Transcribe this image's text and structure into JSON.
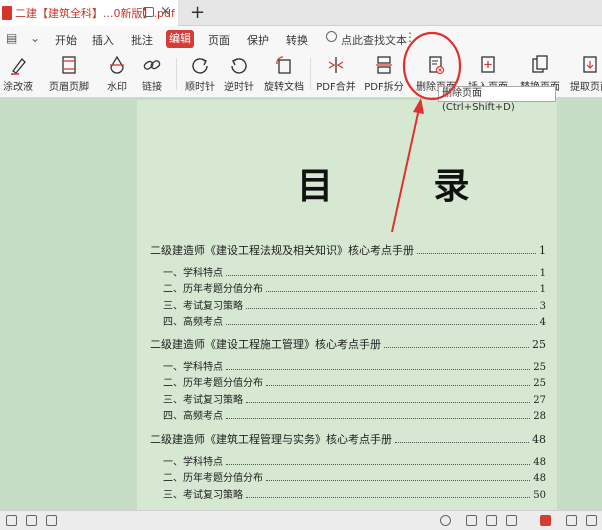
{
  "tab": {
    "title": "二建【建筑全科】...0新版】.pdf",
    "close": "×",
    "add": "+"
  },
  "menu": {
    "items": [
      "开始",
      "插入",
      "批注",
      "编辑",
      "页面",
      "保护",
      "转换"
    ],
    "active": "编辑",
    "search": "点此查找文本"
  },
  "toolbar": {
    "items": [
      {
        "label": "涂改液",
        "icon": "eraser-pen-icon"
      },
      {
        "label": "页眉页脚",
        "icon": "header-footer-icon"
      },
      {
        "label": "水印",
        "icon": "watermark-icon"
      },
      {
        "label": "链接",
        "icon": "link-icon"
      },
      {
        "label": "顺时针",
        "icon": "rotate-cw-icon"
      },
      {
        "label": "逆时针",
        "icon": "rotate-ccw-icon"
      },
      {
        "label": "旋转文档",
        "icon": "rotate-doc-icon"
      },
      {
        "label": "PDF合并",
        "icon": "pdf-merge-icon"
      },
      {
        "label": "PDF拆分",
        "icon": "pdf-split-icon"
      },
      {
        "label": "删除页面",
        "icon": "delete-page-icon"
      },
      {
        "label": "插入页面",
        "icon": "insert-page-icon"
      },
      {
        "label": "替换页面",
        "icon": "replace-page-icon"
      },
      {
        "label": "提取页面",
        "icon": "extract-page-icon"
      }
    ]
  },
  "tooltip": "删除页面 (Ctrl+Shift+D)",
  "document": {
    "title": "目 录",
    "toc": [
      {
        "text": "二级建造师《建设工程法规及相关知识》核心考点手册",
        "page": "1",
        "level": "main"
      },
      {
        "text": "一、学科特点",
        "page": "1",
        "level": "sub"
      },
      {
        "text": "二、历年考题分值分布",
        "page": "1",
        "level": "sub"
      },
      {
        "text": "三、考试复习策略",
        "page": "3",
        "level": "sub"
      },
      {
        "text": "四、高频考点",
        "page": "4",
        "level": "sub"
      },
      {
        "text": "二级建造师《建设工程施工管理》核心考点手册",
        "page": "25",
        "level": "main"
      },
      {
        "text": "一、学科特点",
        "page": "25",
        "level": "sub"
      },
      {
        "text": "二、历年考题分值分布",
        "page": "25",
        "level": "sub"
      },
      {
        "text": "三、考试复习策略",
        "page": "27",
        "level": "sub"
      },
      {
        "text": "四、高频考点",
        "page": "28",
        "level": "sub"
      },
      {
        "text": "二级建造师《建筑工程管理与实务》核心考点手册",
        "page": "48",
        "level": "main"
      },
      {
        "text": "一、学科特点",
        "page": "48",
        "level": "sub"
      },
      {
        "text": "二、历年考题分值分布",
        "page": "48",
        "level": "sub"
      },
      {
        "text": "三、考试复习策略",
        "page": "50",
        "level": "sub"
      }
    ]
  },
  "colors": {
    "accent": "#d33d33",
    "annotation": "#e03030",
    "page_bg": "#d6e8d2",
    "canvas_bg": "#c7dcc4"
  }
}
